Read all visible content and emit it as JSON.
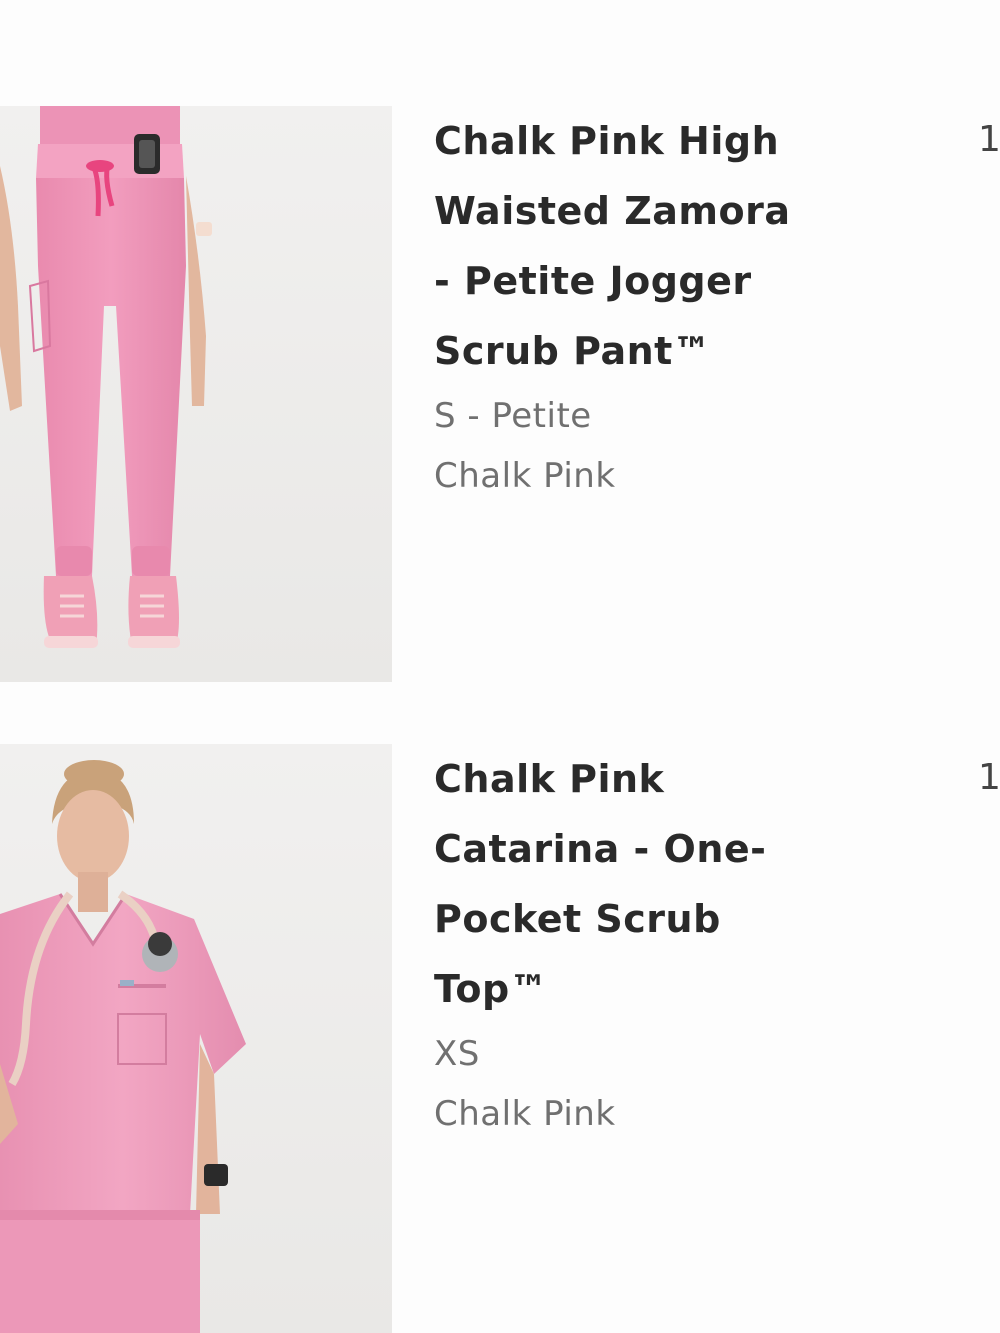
{
  "cart": {
    "items": [
      {
        "title": "Chalk Pink High Waisted Zamora - Petite Jogger Scrub Pant™",
        "size": "S - Petite",
        "color": "Chalk Pink",
        "quantity": "1",
        "image_icon": "pants-product-photo"
      },
      {
        "title": "Chalk Pink Catarina - One-Pocket Scrub Top™",
        "size": "XS",
        "color": "Chalk Pink",
        "quantity": "1",
        "image_icon": "top-product-photo"
      }
    ]
  }
}
